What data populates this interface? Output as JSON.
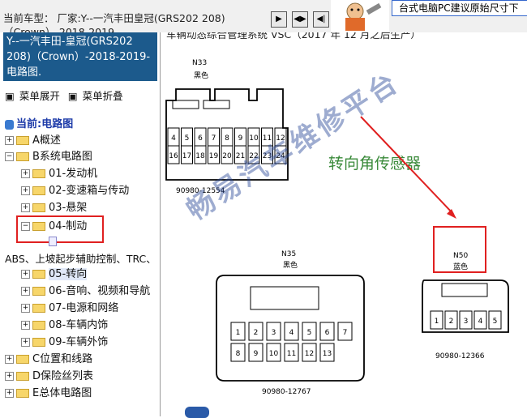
{
  "topbar": {
    "vehicle_line1": "当前车型： 厂家:Y--一汽丰田皇冠(GRS202 208)",
    "vehicle_line2": "（Crown）-2018-2019",
    "nav_buttons": [
      "▶",
      "◀▶",
      "◀|",
      "▶|"
    ],
    "ad_text": "台式电脑PC建议原始尺寸下"
  },
  "left_panel": {
    "vehicle_header": "Y--一汽丰田-皇冠(GRS202 208)（Crown）-2018-2019- 电路图.",
    "menu_expand": "菜单展开",
    "menu_collapse": "菜单折叠",
    "tree": {
      "root": "当前:电路图",
      "items": [
        {
          "label": "A概述"
        },
        {
          "label": "B系统电路图"
        },
        {
          "label": "01-发动机"
        },
        {
          "label": "02-变速箱与传动"
        },
        {
          "label": "03-悬架"
        },
        {
          "label": "04-制动"
        },
        {
          "label": "ABS、上坡起步辅助控制、TRC、"
        },
        {
          "label": "05-转向"
        },
        {
          "label": "06-音响、视频和导航"
        },
        {
          "label": "07-电源和网络"
        },
        {
          "label": "08-车辆内饰"
        },
        {
          "label": "09-车辆外饰"
        },
        {
          "label": "C位置和线路"
        },
        {
          "label": "D保险丝列表"
        },
        {
          "label": "E总体电路图"
        }
      ]
    }
  },
  "diagram": {
    "subtitle": "车辆动态综合管理系统 VSC（2017 年 12 月之后生产）",
    "connector_n33": {
      "name": "N33",
      "color": "黑色",
      "part_no": "90980-12554",
      "pins_row1": [
        "4",
        "5",
        "6",
        "7",
        "8",
        "9",
        "10",
        "11",
        "12"
      ],
      "pins_row2": [
        "16",
        "17",
        "18",
        "19",
        "20",
        "21",
        "22",
        "23",
        "24"
      ]
    },
    "connector_n35": {
      "name": "N35",
      "color": "黑色",
      "part_no": "90980-12767",
      "pins_row1": [
        "1",
        "2",
        "3",
        "4",
        "5",
        "6",
        "7"
      ],
      "pins_row2": [
        "8",
        "9",
        "10",
        "11",
        "12",
        "13"
      ]
    },
    "connector_n50": {
      "name": "N50",
      "color": "蓝色",
      "part_no": "90980-12366",
      "pins": [
        "1",
        "2",
        "3",
        "4",
        "5"
      ]
    },
    "sensor_label": "转向角传感器",
    "watermark": "畅易汽车维修平台",
    "colors": {
      "arrow": "#e02020",
      "label": "#3a8a3a",
      "header": "#1c5a8c",
      "highlight": "#e02020"
    }
  }
}
